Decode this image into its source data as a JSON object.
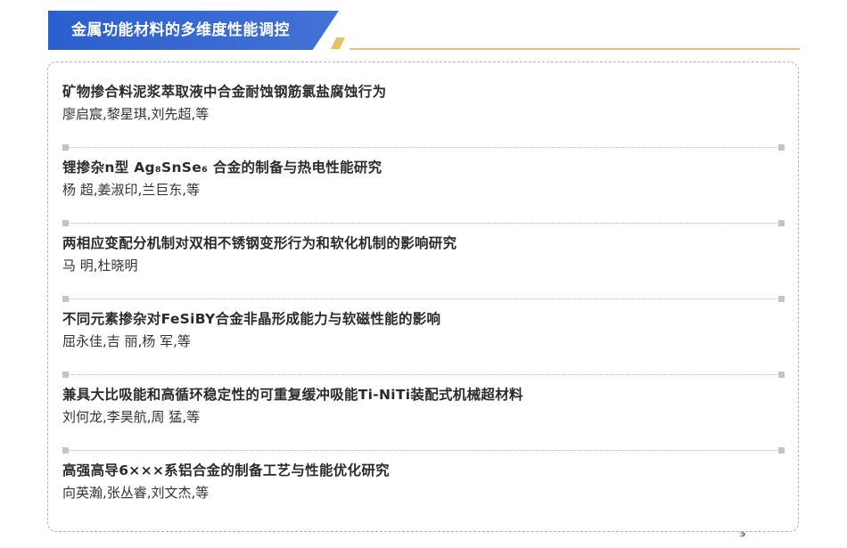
{
  "header": {
    "title": "金属功能材料的多维度性能调控"
  },
  "articles": [
    {
      "title": "矿物掺合料泥浆萃取液中合金耐蚀钢筋氯盐腐蚀行为",
      "authors": "廖启宸,黎星琪,刘先超,等"
    },
    {
      "title": "锂掺杂n型 Ag₈SnSe₆ 合金的制备与热电性能研究",
      "authors": "杨  超,姜淑印,兰巨东,等"
    },
    {
      "title": "两相应变配分机制对双相不锈钢变形行为和软化机制的影响研究",
      "authors": "马  明,杜晓明"
    },
    {
      "title": "不同元素掺杂对FeSiBY合金非晶形成能力与软磁性能的影响",
      "authors": "屈永佳,吉  丽,杨  军,等"
    },
    {
      "title": "兼具大比吸能和高循环稳定性的可重复缓冲吸能Ti-NiTi装配式机械超材料",
      "authors": "刘何龙,李昊航,周  猛,等"
    },
    {
      "title": "高强高导6×××系铝合金的制备工艺与性能优化研究",
      "authors": "向英瀚,张丛睿,刘文杰,等"
    }
  ],
  "nav_arrows": {
    "glyphs": [
      "›",
      "›",
      "›"
    ],
    "colors": [
      "#f0a8c8",
      "#f2c94c",
      "#3b6fe0"
    ]
  },
  "colors": {
    "banner": "#2a5fcf",
    "accent_gold": "#e2c27a",
    "box_border": "#a9acd9"
  }
}
